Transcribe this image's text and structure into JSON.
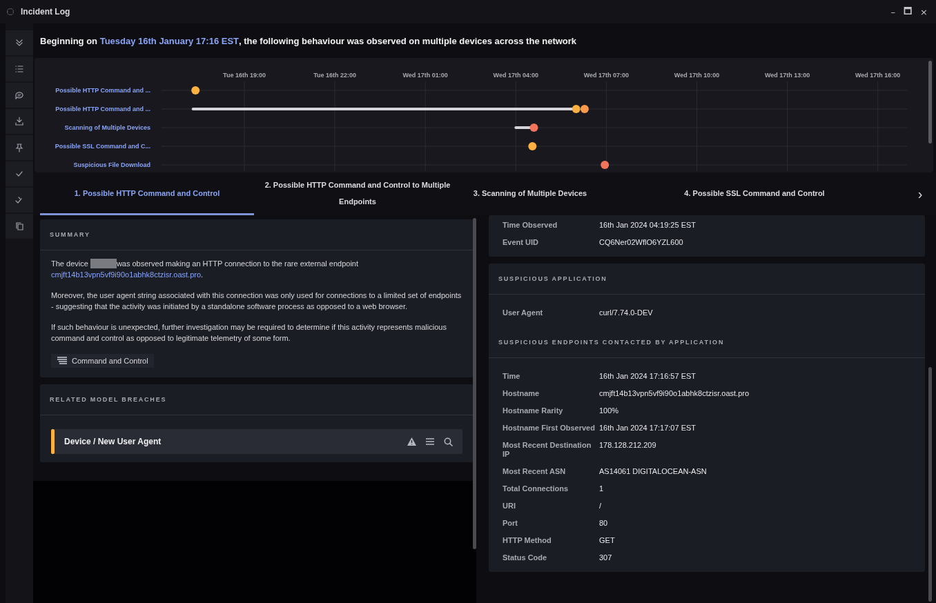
{
  "window": {
    "title": "Incident Log",
    "controls": [
      "–",
      "🗖",
      "×"
    ]
  },
  "sidebar": {
    "items": [
      {
        "kind": "collapse"
      },
      {
        "kind": "list"
      },
      {
        "kind": "comment"
      },
      {
        "kind": "download"
      },
      {
        "kind": "pin"
      },
      {
        "kind": "check"
      },
      {
        "kind": "double-check"
      },
      {
        "kind": "copy"
      }
    ]
  },
  "headline": {
    "before": "Beginning on ",
    "highlight": "Tuesday 16th January 17:16 EST",
    "after": ", the following behaviour was observed on multiple devices across the network"
  },
  "timeline": {
    "ticks": [
      "Tue 16th 19:00",
      "Tue 16th 22:00",
      "Wed 17th 01:00",
      "Wed 17th 04:00",
      "Wed 17th 07:00",
      "Wed 17th 10:00",
      "Wed 17th 13:00",
      "Wed 17th 16:00"
    ],
    "rows": [
      {
        "label": "Possible HTTP Command and ..."
      },
      {
        "label": "Possible HTTP Command and ..."
      },
      {
        "label": "Scanning of Multiple Devices"
      },
      {
        "label": "Possible SSL Command and C..."
      },
      {
        "label": "Suspicious File Download"
      }
    ]
  },
  "tabs": [
    {
      "label": "1. Possible HTTP Command and Control",
      "selected": true
    },
    {
      "label": "2. Possible HTTP Command and Control to Multiple Endpoints",
      "selected": false
    },
    {
      "label": "3. Scanning of Multiple Devices",
      "selected": false
    },
    {
      "label": "4. Possible SSL Command and Control",
      "selected": false
    }
  ],
  "tabs_next": "›",
  "summary": {
    "title": "SUMMARY",
    "intro": {
      "before": "The device ",
      "redacted": true,
      "after": "was observed making an HTTP connection to the rare external endpoint",
      "link": "cmjft14b13vpn5vf9i90o1abhk8ctzisr.oast.pro",
      "end": "."
    },
    "paragraphs": [
      "Moreover, the user agent string associated with this connection was only used for connections to a limited set of endpoints - suggesting that the activity was initiated by a standalone software process as opposed to a web browser.",
      "If such behaviour is unexpected, further investigation may be required to determine if this activity represents malicious command and control as opposed to legitimate telemetry of some form."
    ],
    "tag": "Command and Control"
  },
  "related": {
    "title": "RELATED MODEL BREACHES",
    "items": [
      {
        "name": "Device / New User Agent",
        "color": "#fbb040"
      }
    ]
  },
  "event": {
    "rows": [
      {
        "label": "Time Observed",
        "value": "16th Jan 2024 04:19:25 EST"
      },
      {
        "label": "Event UID",
        "value": "CQ6Ner02WflO6YZL600"
      }
    ]
  },
  "application": {
    "title": "SUSPICIOUS APPLICATION",
    "rows": [
      {
        "label": "User Agent",
        "value": "curl/7.74.0-DEV"
      }
    ],
    "endpoints_title": "SUSPICIOUS ENDPOINTS CONTACTED BY APPLICATION",
    "endpoints": [
      {
        "label": "Time",
        "value": "16th Jan 2024 17:16:57 EST"
      },
      {
        "label": "Hostname",
        "value": "cmjft14b13vpn5vf9i90o1abhk8ctzisr.oast.pro"
      },
      {
        "label": "Hostname Rarity",
        "value": "100%"
      },
      {
        "label": "Hostname First Observed",
        "value": "16th Jan 2024 17:17:07 EST"
      },
      {
        "label": "Most Recent Destination IP",
        "value": "178.128.212.209"
      },
      {
        "label": "Most Recent ASN",
        "value": "AS14061 DIGITALOCEAN-ASN"
      },
      {
        "label": "Total Connections",
        "value": "1"
      },
      {
        "label": "URI",
        "value": "/"
      },
      {
        "label": "Port",
        "value": "80"
      },
      {
        "label": "HTTP Method",
        "value": "GET"
      },
      {
        "label": "Status Code",
        "value": "307"
      }
    ]
  }
}
